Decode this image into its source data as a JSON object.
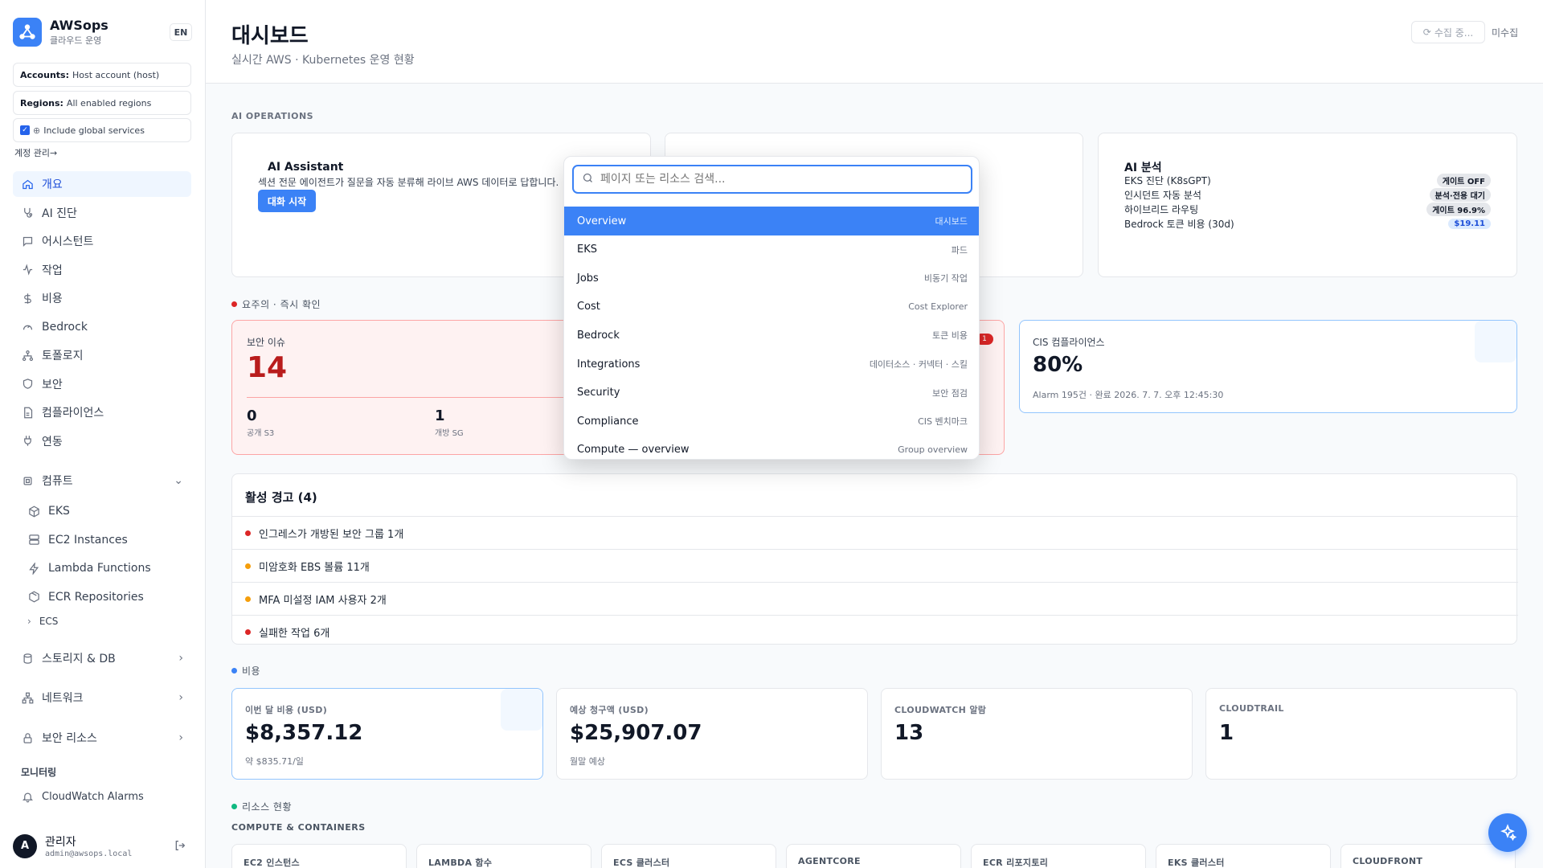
{
  "sidebar": {
    "brand_title": "AWSops",
    "brand_sub": "클라우드 운영",
    "lang": "EN",
    "accounts_key": "Accounts:",
    "accounts_val": "Host account (host)",
    "regions_key": "Regions:",
    "regions_val": "All enabled regions",
    "global_label": "Include global services",
    "account_mgmt": "계정 관리→",
    "nav": [
      {
        "label": "개요",
        "icon": "home-icon"
      },
      {
        "label": "AI 진단",
        "icon": "stethoscope-icon"
      },
      {
        "label": "어시스턴트",
        "icon": "chat-icon"
      },
      {
        "label": "작업",
        "icon": "activity-icon"
      },
      {
        "label": "비용",
        "icon": "dollar-icon"
      },
      {
        "label": "Bedrock",
        "icon": "gauge-icon"
      },
      {
        "label": "토폴로지",
        "icon": "network-icon"
      },
      {
        "label": "보안",
        "icon": "shield-icon"
      },
      {
        "label": "컴플라이언스",
        "icon": "document-icon"
      },
      {
        "label": "연동",
        "icon": "plug-icon"
      }
    ],
    "compute_label": "컴퓨트",
    "compute_items": [
      "EKS",
      "EC2 Instances",
      "Lambda Functions",
      "ECR Repositories"
    ],
    "ecs_label": "ECS",
    "storage_label": "스토리지 & DB",
    "network_label": "네트워크",
    "security_res_label": "보안 리소스",
    "monitoring_label": "모니터링",
    "cloudwatch_label": "CloudWatch Alarms",
    "user_initial": "A",
    "user_name": "관리자",
    "user_email": "admin@awsops.local"
  },
  "header": {
    "title": "대시보드",
    "subtitle": "실시간 AWS · Kubernetes 운영 현황",
    "collect_label": "수집 중...",
    "uncollected_label": "미수집"
  },
  "ai_ops": {
    "section": "AI OPERATIONS",
    "assistant_title": "AI Assistant",
    "assistant_desc": "섹션 전문 에이전트가 질문을 자동 분류해 라이브 AWS 데이터로 답합니다.",
    "start_label": "대화 시작",
    "analysis_title": "AI 분석",
    "analysis_rows": [
      {
        "label": "EKS 진단 (K8sGPT)",
        "badge": "게이트 OFF"
      },
      {
        "label": "인시던트 자동 분석",
        "badge": "분석·전용 대기"
      },
      {
        "label": "하이브리드 라우팅",
        "badge": "게이트 96.9%"
      },
      {
        "label": "Bedrock 토큰 비용 (30d)",
        "badge": "$19.11"
      }
    ]
  },
  "attention": {
    "section": "요주의 · 즉시 확인",
    "sec_title": "보안 이슈",
    "sec_value": "14",
    "stats": [
      {
        "value": "0",
        "label": "공개 S3"
      },
      {
        "value": "1",
        "label": "개방 SG"
      }
    ],
    "cis_title": "CIS 컴플라이언스",
    "cis_value": "80%",
    "cis_sub": "Alarm 195건 · 완료 2026. 7. 7. 오후 12:45:30",
    "hidden_badge": "1"
  },
  "alerts": {
    "title": "활성 경고 (4)",
    "items": [
      {
        "text": "인그레스가 개방된 보안 그룹 1개",
        "color": "#dc2626"
      },
      {
        "text": "미암호화 EBS 볼륨 11개",
        "color": "#f59e0b"
      },
      {
        "text": "MFA 미설정 IAM 사용자 2개",
        "color": "#f59e0b"
      },
      {
        "text": "실패한 작업 6개",
        "color": "#dc2626"
      }
    ]
  },
  "cost": {
    "section": "비용",
    "cards": [
      {
        "label": "이번 달 비용 (USD)",
        "value": "$8,357.12",
        "sub": "약 $835.71/일"
      },
      {
        "label": "예상 청구액 (USD)",
        "value": "$25,907.07",
        "sub": "월말 예상"
      },
      {
        "label": "CLOUDWATCH 알람",
        "value": "13",
        "sub": ""
      },
      {
        "label": "CLOUDTRAIL",
        "value": "1",
        "sub": ""
      }
    ]
  },
  "resources": {
    "section": "리소스 현황",
    "group": "COMPUTE & CONTAINERS",
    "cards": [
      "EC2 인스턴스",
      "LAMBDA 함수",
      "ECS 클러스터",
      "AGENTCORE",
      "ECR 리포지토리",
      "EKS 클러스터",
      "CLOUDFRONT"
    ]
  },
  "palette": {
    "placeholder": "페이지 또는 리소스 검색...",
    "items": [
      {
        "label": "Overview",
        "hint": "대시보드"
      },
      {
        "label": "EKS",
        "hint": "파드"
      },
      {
        "label": "Jobs",
        "hint": "비동기 작업"
      },
      {
        "label": "Cost",
        "hint": "Cost Explorer"
      },
      {
        "label": "Bedrock",
        "hint": "토큰 비용"
      },
      {
        "label": "Integrations",
        "hint": "데이터소스 · 커넥터 · 스킬"
      },
      {
        "label": "Security",
        "hint": "보안 점검"
      },
      {
        "label": "Compliance",
        "hint": "CIS 벤치마크"
      },
      {
        "label": "Compute — overview",
        "hint": "Group overview"
      }
    ]
  },
  "colors": {
    "accent": "#3b82f6",
    "danger": "#dc2626",
    "warning": "#f59e0b",
    "success": "#10b981"
  }
}
